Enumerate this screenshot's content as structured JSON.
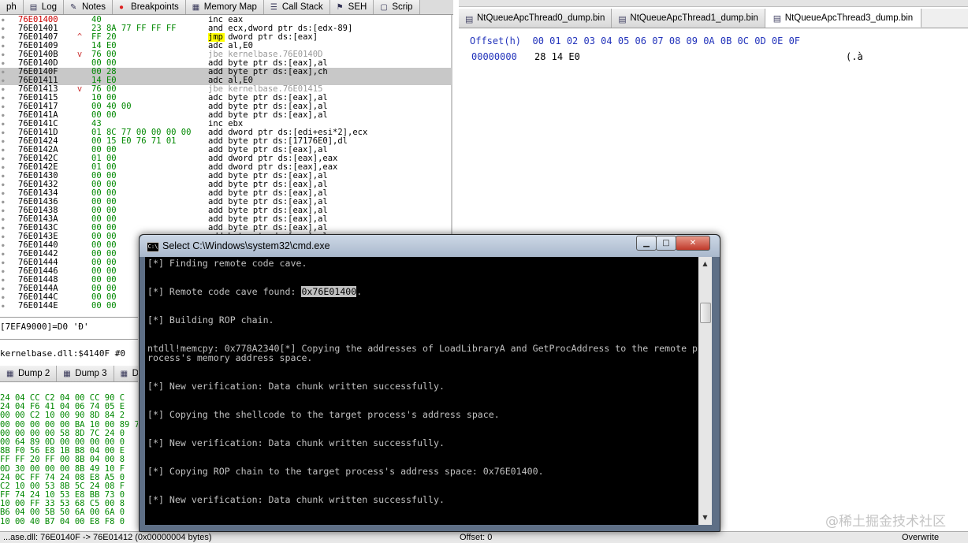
{
  "debugger_tabs": [
    {
      "label": "ph",
      "icon": ""
    },
    {
      "label": "Log",
      "icon": "log-icon"
    },
    {
      "label": "Notes",
      "icon": "notes-icon"
    },
    {
      "label": "Breakpoints",
      "icon": "breakpoint-icon"
    },
    {
      "label": "Memory Map",
      "icon": "memory-map-icon"
    },
    {
      "label": "Call Stack",
      "icon": "call-stack-icon"
    },
    {
      "label": "SEH",
      "icon": "seh-icon"
    },
    {
      "label": "Scrip",
      "icon": "script-icon"
    }
  ],
  "disasm": [
    {
      "addr": "76E01400",
      "arrow": "",
      "bytes": "40",
      "instr": "inc eax",
      "hl": true
    },
    {
      "addr": "76E01401",
      "arrow": "",
      "bytes": "23 8A 77 FF FF FF",
      "instr": "and ecx,dword ptr ds:[edx-89]"
    },
    {
      "addr": "76E01407",
      "arrow": "^",
      "bytes": "FF 20",
      "instr": "jmp dword ptr ds:[eax]"
    },
    {
      "addr": "76E01409",
      "arrow": "",
      "bytes": "14 E0",
      "instr": "adc al,E0"
    },
    {
      "addr": "76E0140B",
      "arrow": "v",
      "bytes": "76 00",
      "instr": "jbe kernelbase.76E0140D",
      "jb": true
    },
    {
      "addr": "76E0140D",
      "arrow": "",
      "bytes": "00 00",
      "instr": "add byte ptr ds:[eax],al"
    },
    {
      "addr": "76E0140F",
      "arrow": "",
      "bytes": "00 28",
      "instr": "add byte ptr ds:[eax],ch",
      "sel": true
    },
    {
      "addr": "76E01411",
      "arrow": "",
      "bytes": "14 E0",
      "instr": "adc al,E0",
      "sel": true
    },
    {
      "addr": "76E01413",
      "arrow": "v",
      "bytes": "76 00",
      "instr": "jbe kernelbase.76E01415",
      "jb": true
    },
    {
      "addr": "76E01415",
      "arrow": "",
      "bytes": "10 00",
      "instr": "adc byte ptr ds:[eax],al"
    },
    {
      "addr": "76E01417",
      "arrow": "",
      "bytes": "00 40 00",
      "instr": "add byte ptr ds:[eax],al"
    },
    {
      "addr": "76E0141A",
      "arrow": "",
      "bytes": "00 00",
      "instr": "add byte ptr ds:[eax],al"
    },
    {
      "addr": "76E0141C",
      "arrow": "",
      "bytes": "43",
      "instr": "inc ebx"
    },
    {
      "addr": "76E0141D",
      "arrow": "",
      "bytes": "01 8C 77 00 00 00 00",
      "instr": "add dword ptr ds:[edi+esi*2],ecx"
    },
    {
      "addr": "76E01424",
      "arrow": "",
      "bytes": "00 15 E0 76 71 01",
      "instr": "add byte ptr ds:[17176E0],dl"
    },
    {
      "addr": "76E0142A",
      "arrow": "",
      "bytes": "00 00",
      "instr": "add byte ptr ds:[eax],al"
    },
    {
      "addr": "76E0142C",
      "arrow": "",
      "bytes": "01 00",
      "instr": "add dword ptr ds:[eax],eax"
    },
    {
      "addr": "76E0142E",
      "arrow": "",
      "bytes": "01 00",
      "instr": "add dword ptr ds:[eax],eax"
    },
    {
      "addr": "76E01430",
      "arrow": "",
      "bytes": "00 00",
      "instr": "add byte ptr ds:[eax],al"
    },
    {
      "addr": "76E01432",
      "arrow": "",
      "bytes": "00 00",
      "instr": "add byte ptr ds:[eax],al"
    },
    {
      "addr": "76E01434",
      "arrow": "",
      "bytes": "00 00",
      "instr": "add byte ptr ds:[eax],al"
    },
    {
      "addr": "76E01436",
      "arrow": "",
      "bytes": "00 00",
      "instr": "add byte ptr ds:[eax],al"
    },
    {
      "addr": "76E01438",
      "arrow": "",
      "bytes": "00 00",
      "instr": "add byte ptr ds:[eax],al"
    },
    {
      "addr": "76E0143A",
      "arrow": "",
      "bytes": "00 00",
      "instr": "add byte ptr ds:[eax],al"
    },
    {
      "addr": "76E0143C",
      "arrow": "",
      "bytes": "00 00",
      "instr": "add byte ptr ds:[eax],al"
    },
    {
      "addr": "76E0143E",
      "arrow": "",
      "bytes": "00 00",
      "instr": "add byte ptr ds:[eax],al"
    },
    {
      "addr": "76E01440",
      "arrow": "",
      "bytes": "00 00",
      "instr": ""
    },
    {
      "addr": "76E01442",
      "arrow": "",
      "bytes": "00 00",
      "instr": ""
    },
    {
      "addr": "76E01444",
      "arrow": "",
      "bytes": "00 00",
      "instr": ""
    },
    {
      "addr": "76E01446",
      "arrow": "",
      "bytes": "00 00",
      "instr": ""
    },
    {
      "addr": "76E01448",
      "arrow": "",
      "bytes": "00 00",
      "instr": ""
    },
    {
      "addr": "76E0144A",
      "arrow": "",
      "bytes": "00 00",
      "instr": ""
    },
    {
      "addr": "76E0144C",
      "arrow": "",
      "bytes": "00 00",
      "instr": ""
    },
    {
      "addr": "76E0144E",
      "arrow": "",
      "bytes": "00 00",
      "instr": ""
    }
  ],
  "info_line1": "[7EFA9000]=D0 'Ð'",
  "info_line2": "kernelbase.dll:$4140F #0",
  "dump_tabs": [
    {
      "label": "Dump 2",
      "icon": "dump-icon"
    },
    {
      "label": "Dump 3",
      "icon": "dump-icon"
    },
    {
      "label": "Du",
      "icon": "dump-icon"
    }
  ],
  "dump_rows": [
    "24 04 CC C2 04 00 CC 90 C",
    "24 04 F6 41 04 06 74 05 E",
    "00 00 C2 10 00 90 8D 84 2",
    "00 00 00 00 00 BA 10 00 89 7",
    "00 00 00 00 58 8D 7C 24 0",
    "00 64 89 0D 00 00 00 00 0",
    "8B F0 56 E8 1B B8 04 00 E",
    "FF FF 20 FF 00 8B 04 00 8",
    "0D 30 00 00 00 8B 49 10 F",
    "24 0C FF 74 24 08 E8 A5 0",
    "C2 10 00 53 8B 5C 24 08 F",
    "FF 74 24 10 53 E8 BB 73 0",
    "10 00 FF 33 53 68 C5 00 8",
    "B6 04 00 5B 50 6A 00 6A 0",
    "10 00 40 B7 04 00 E8 F8 0"
  ],
  "status_left": "...ase.dll: 76E0140F -> 76E01412 (0x00000004 bytes)",
  "hex_tabs": [
    {
      "label": "NtQueueApcThread0_dump.bin",
      "active": false
    },
    {
      "label": "NtQueueApcThread1_dump.bin",
      "active": false
    },
    {
      "label": "NtQueueApcThread3_dump.bin",
      "active": true
    }
  ],
  "hex_header": "Offset(h)  00 01 02 03 04 05 06 07 08 09 0A 0B 0C 0D 0E 0F",
  "hex_row": {
    "offset": "00000000",
    "bytes": "28 14 E0",
    "ascii": "(.à"
  },
  "hex_status": "Offset: 0",
  "hex_mode": "Overwrite",
  "cmd": {
    "title": "Select C:\\Windows\\system32\\cmd.exe",
    "lines": [
      "[*] Finding remote code cave.",
      "",
      "",
      "[*] Remote code cave found: ",
      "",
      "",
      "[*] Building ROP chain.",
      "",
      "",
      "ntdll!memcpy: 0x778A2340[*] Copying the addresses of LoadLibraryA and GetProcAddress to the remote p",
      "rocess's memory address space.",
      "",
      "",
      "[*] New verification: Data chunk written successfully.",
      "",
      "",
      "[*] Copying the shellcode to the target process's address space.",
      "",
      "",
      "[*] New verification: Data chunk written successfully.",
      "",
      "",
      "[*] Copying ROP chain to the target process's address space: 0x76E01400.",
      "",
      "",
      "[*] New verification: Data chunk written successfully."
    ],
    "highlight": "0x76E01400",
    "highlight_suffix": "."
  },
  "watermark": "@稀土掘金技术社区"
}
